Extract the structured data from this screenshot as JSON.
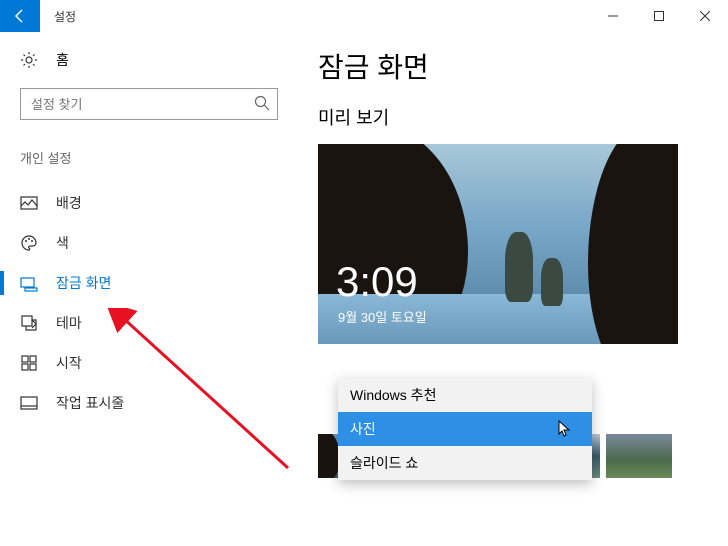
{
  "titlebar": {
    "title": "설정"
  },
  "sidebar": {
    "home": "홈",
    "search_placeholder": "설정 찾기",
    "section": "개인 설정",
    "items": [
      {
        "label": "배경"
      },
      {
        "label": "색"
      },
      {
        "label": "잠금 화면"
      },
      {
        "label": "테마"
      },
      {
        "label": "시작"
      },
      {
        "label": "작업 표시줄"
      }
    ]
  },
  "main": {
    "title": "잠금 화면",
    "preview_label": "미리 보기",
    "preview_time": "3:09",
    "preview_date": "9월 30일 토요일"
  },
  "dropdown": {
    "items": [
      {
        "label": "Windows 추천"
      },
      {
        "label": "사진"
      },
      {
        "label": "슬라이드 쇼"
      }
    ]
  }
}
